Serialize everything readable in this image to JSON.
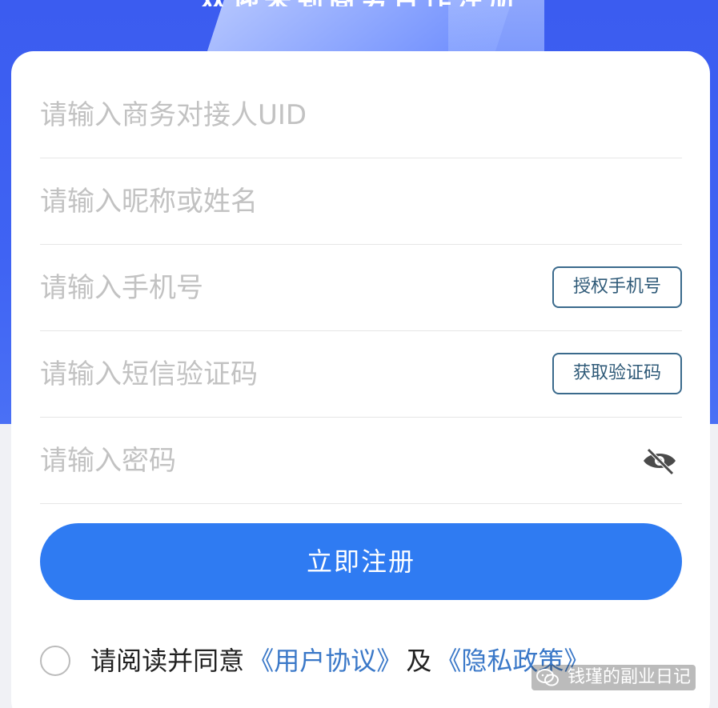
{
  "hero": {
    "headline": "欢迎来到商务合作注册"
  },
  "form": {
    "uid_placeholder": "请输入商务对接人UID",
    "name_placeholder": "请输入昵称或姓名",
    "phone_placeholder": "请输入手机号",
    "authorize_phone_label": "授权手机号",
    "sms_placeholder": "请输入短信验证码",
    "get_code_label": "获取验证码",
    "password_placeholder": "请输入密码",
    "password_toggle_icon": "eye-slash-icon"
  },
  "submit": {
    "label": "立即注册"
  },
  "agreement": {
    "prefix": "请阅读并同意",
    "user_agreement": "《用户协议》",
    "and": "及",
    "privacy_policy": "《隐私政策》",
    "checked": false
  },
  "watermark": {
    "icon": "wechat-icon",
    "text": "钱瑾的副业日记"
  },
  "colors": {
    "hero_blue": "#3f63f3",
    "primary_button": "#2f7bf2",
    "link": "#3a78c8",
    "outline_button": "#3a6a8c"
  }
}
